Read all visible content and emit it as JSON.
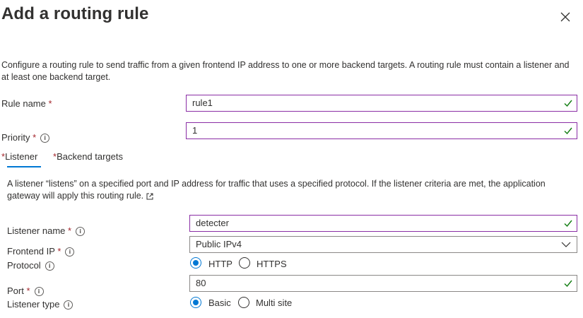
{
  "title": "Add a routing rule",
  "description": "Configure a routing rule to send traffic from a given frontend IP address to one or more backend targets. A routing rule must contain a listener and at least one backend target.",
  "fields": {
    "rule_name": {
      "label": "Rule name",
      "value": "rule1"
    },
    "priority": {
      "label": "Priority",
      "value": "1"
    }
  },
  "tabs": [
    {
      "label": "Listener",
      "selected": true
    },
    {
      "label": "Backend targets",
      "selected": false
    }
  ],
  "required_marker": "*",
  "listener": {
    "description": "A listener “listens” on a specified port and IP address for traffic that uses a specified protocol. If the listener criteria are met, the application gateway will apply this routing rule.",
    "listener_name": {
      "label": "Listener name",
      "value": "detecter"
    },
    "frontend_ip": {
      "label": "Frontend IP",
      "value": "Public IPv4"
    },
    "protocol": {
      "label": "Protocol",
      "options": [
        "HTTP",
        "HTTPS"
      ],
      "selected": "HTTP"
    },
    "port": {
      "label": "Port",
      "value": "80"
    },
    "listener_type": {
      "label": "Listener type",
      "options": [
        "Basic",
        "Multi site"
      ],
      "selected": "Basic"
    }
  },
  "colors": {
    "accent": "#0078d4",
    "focus_border": "#8a2da5",
    "valid_check": "#107c10",
    "required": "#a4262c"
  }
}
